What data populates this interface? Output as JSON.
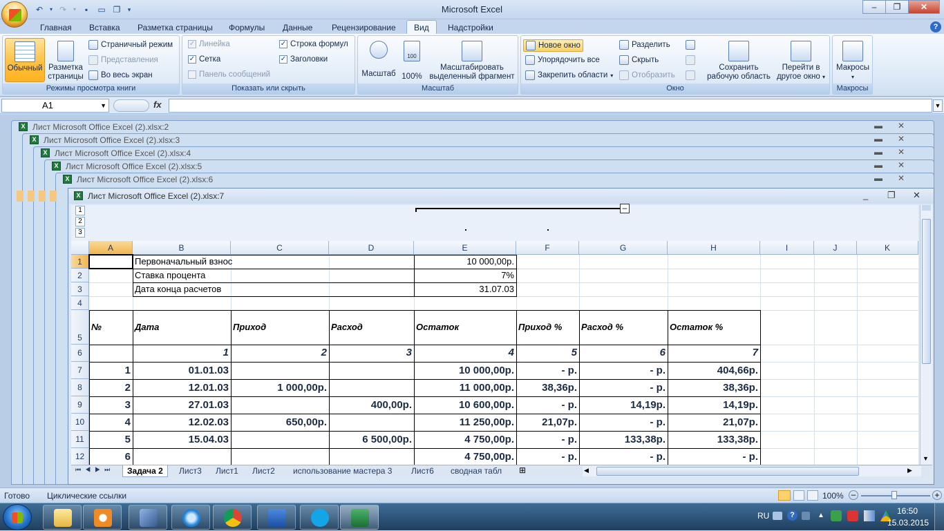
{
  "app": {
    "title": "Microsoft Excel"
  },
  "tabs": [
    "Главная",
    "Вставка",
    "Разметка страницы",
    "Формулы",
    "Данные",
    "Рецензирование",
    "Вид",
    "Надстройки"
  ],
  "active_tab": "Вид",
  "ribbon": {
    "views": {
      "label": "Режимы просмотра книги",
      "normal": "Обычный",
      "page_layout_1": "Разметка",
      "page_layout_2": "страницы",
      "page_break": "Страничный режим",
      "custom_views": "Представления",
      "full_screen": "Во весь экран"
    },
    "show_hide": {
      "label": "Показать или скрыть",
      "ruler": "Линейка",
      "gridlines": "Сетка",
      "message_bar": "Панель сообщений",
      "formula_bar": "Строка формул",
      "headings": "Заголовки"
    },
    "zoom": {
      "label": "Масштаб",
      "zoom": "Масштаб",
      "pct100": "100%",
      "zoom_sel_1": "Масштабировать",
      "zoom_sel_2": "выделенный фрагмент"
    },
    "window": {
      "label": "Окно",
      "new_window": "Новое окно",
      "arrange_all": "Упорядочить все",
      "freeze": "Закрепить области",
      "split": "Разделить",
      "hide": "Скрыть",
      "unhide": "Отобразить",
      "save_ws_1": "Сохранить",
      "save_ws_2": "рабочую область",
      "switch_1": "Перейти в",
      "switch_2": "другое окно"
    },
    "macros": {
      "label": "Макросы",
      "macros": "Макросы"
    }
  },
  "formula_bar": {
    "name_box": "A1",
    "fx": "fx",
    "value": ""
  },
  "cascade_windows": [
    "Лист Microsoft Office Excel (2).xlsx:2",
    "Лист Microsoft Office Excel (2).xlsx:3",
    "Лист Microsoft Office Excel (2).xlsx:4",
    "Лист Microsoft Office Excel (2).xlsx:5",
    "Лист Microsoft Office Excel (2).xlsx:6"
  ],
  "main_window": {
    "title": "Лист Microsoft Office Excel (2).xlsx:7"
  },
  "outline_levels": [
    "1",
    "2",
    "3"
  ],
  "columns": [
    "A",
    "B",
    "C",
    "D",
    "E",
    "F",
    "G",
    "H",
    "I",
    "J",
    "K"
  ],
  "rows": [
    "1",
    "2",
    "3",
    "4",
    "5",
    "6",
    "7",
    "8",
    "9",
    "10",
    "11",
    "12"
  ],
  "sheet": {
    "r1": {
      "label": "Первоначальный взнос",
      "value": "10 000,00р."
    },
    "r2": {
      "label": "Ставка процента",
      "value": "7%"
    },
    "r3": {
      "label": "Дата конца расчетов",
      "value": "31.07.03"
    },
    "headers": [
      "№",
      "Дата",
      "Приход",
      "Расход",
      "Остаток",
      "Приход %",
      "Расход %",
      "Остаток %"
    ],
    "col_numbers": [
      "1",
      "2",
      "3",
      "4",
      "5",
      "6",
      "7"
    ],
    "data": [
      [
        "1",
        "01.01.03",
        "",
        "",
        "10 000,00р.",
        "-    р.",
        "-    р.",
        "404,66р."
      ],
      [
        "2",
        "12.01.03",
        "1 000,00р.",
        "",
        "11 000,00р.",
        "38,36р.",
        "-    р.",
        "38,36р."
      ],
      [
        "3",
        "27.01.03",
        "",
        "400,00р.",
        "10 600,00р.",
        "-    р.",
        "14,19р.",
        "14,19р."
      ],
      [
        "4",
        "12.02.03",
        "650,00р.",
        "",
        "11 250,00р.",
        "21,07р.",
        "-    р.",
        "21,07р."
      ],
      [
        "5",
        "15.04.03",
        "",
        "6 500,00р.",
        "4 750,00р.",
        "-    р.",
        "133,38р.",
        "133,38р."
      ],
      [
        "6",
        "",
        "",
        "",
        "4 750,00р.",
        "-    р.",
        "-    р.",
        "-    р."
      ]
    ]
  },
  "sheet_tabs": [
    "Задача 2",
    "Лист3",
    "Лист1",
    "Лист2",
    "использование мастера 3",
    "Лист6",
    "сводная табл"
  ],
  "active_sheet": "Задача 2",
  "status": {
    "ready": "Готово",
    "circular": "Циклические ссылки",
    "zoom": "100%"
  },
  "taskbar": {
    "lang": "RU",
    "time": "16:50",
    "date": "15.03.2015"
  }
}
